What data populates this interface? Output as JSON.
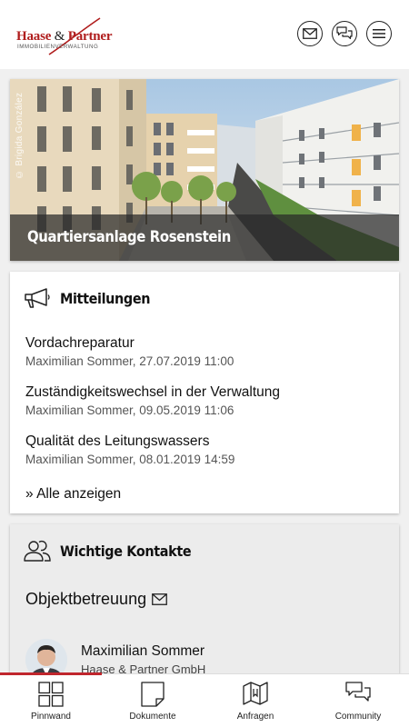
{
  "header": {
    "logo_main_part1": "Haase",
    "logo_amp": " & ",
    "logo_main_part2": "Partner",
    "logo_sub": "IMMOBILIENVERWALTUNG",
    "mail_icon": "envelope-icon",
    "chat_icon": "chat-bubbles-icon",
    "menu_icon": "hamburger-menu-icon"
  },
  "hero": {
    "credit": "© Brigida González",
    "caption": "Quartiersanlage Rosenstein"
  },
  "messages": {
    "title": "Mitteilungen",
    "icon": "megaphone-icon",
    "items": [
      {
        "title": "Vordachreparatur",
        "meta": "Maximilian Sommer, 27.07.2019 11:00"
      },
      {
        "title": "Zuständigkeitswechsel in der Verwaltung",
        "meta": "Maximilian Sommer, 09.05.2019 11:06"
      },
      {
        "title": "Qualität des Leitungswassers",
        "meta": "Maximilian Sommer, 08.01.2019 14:59"
      }
    ],
    "show_all": "» Alle anzeigen"
  },
  "contacts": {
    "title": "Wichtige Kontakte",
    "icon": "people-icon",
    "section_title": "Objektbetreuung",
    "section_icon": "envelope-icon",
    "contact_name": "Maximilian Sommer",
    "contact_company": "Haase & Partner GmbH"
  },
  "nav": {
    "active_index": 0,
    "accent_color": "#c0262d",
    "items": [
      {
        "label": "Pinnwand",
        "icon": "grid-icon"
      },
      {
        "label": "Dokumente",
        "icon": "document-icon"
      },
      {
        "label": "Anfragen",
        "icon": "map-folder-icon"
      },
      {
        "label": "Community",
        "icon": "chat-bubbles-icon"
      }
    ]
  },
  "colors": {
    "brand_red": "#b01d1d",
    "background": "#f0f0f0"
  }
}
